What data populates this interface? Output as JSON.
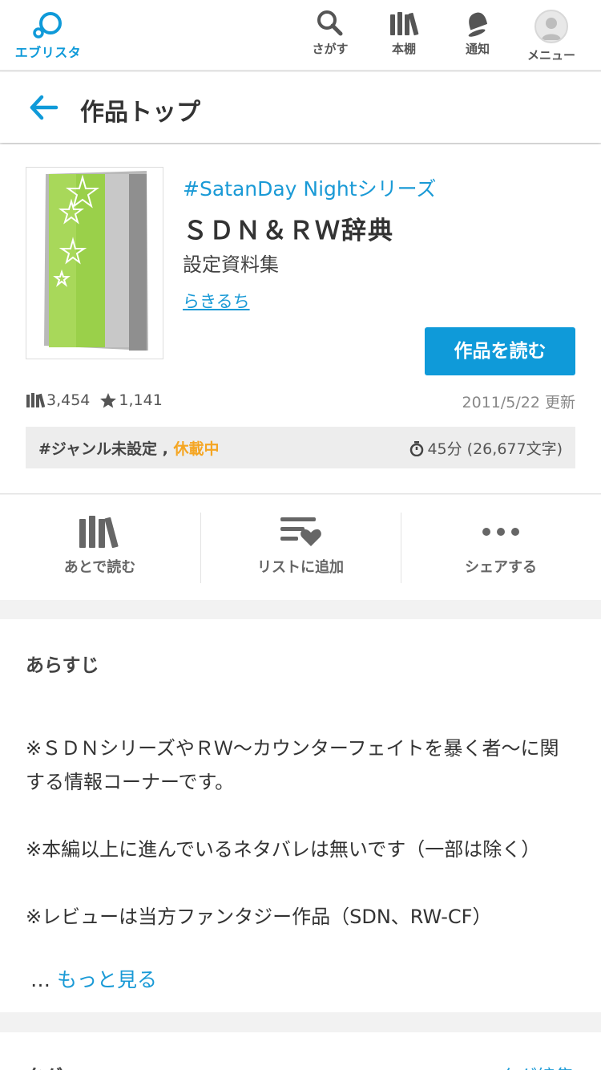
{
  "app": {
    "logo_text": "エブリスタ",
    "brand_color": "#0f9ad9"
  },
  "nav": [
    {
      "label": "さがす",
      "icon": "search-icon"
    },
    {
      "label": "本棚",
      "icon": "bookshelf-icon"
    },
    {
      "label": "通知",
      "icon": "bell-icon"
    },
    {
      "label": "メニュー",
      "icon": "avatar-icon"
    }
  ],
  "page": {
    "title": "作品トップ",
    "back_icon": "back-arrow-icon"
  },
  "work": {
    "series": "#SatanDay Nightシリーズ",
    "title": "ＳＤＮ＆ＲＷ辞典",
    "subtitle": "設定資料集",
    "author": "らきるち",
    "read_button": "作品を読む",
    "bookshelf_count": "3,454",
    "star_count": "1,141",
    "updated": "2011/5/22 更新",
    "genre": "#ジャンル未設定",
    "separator": ",",
    "status": "休載中",
    "read_time": "45分 (26,677文字)"
  },
  "actions": [
    {
      "label": "あとで読む",
      "icon": "bookshelf-icon"
    },
    {
      "label": "リストに追加",
      "icon": "list-heart-icon"
    },
    {
      "label": "シェアする",
      "icon": "more-dots-icon"
    }
  ],
  "synopsis": {
    "heading": "あらすじ",
    "paragraphs": [
      "※ＳＤＮシリーズやＲＷ～カウンターフェイトを暴く者～に関する情報コーナーです。",
      "※本編以上に進んでいるネタバレは無いです（一部は除く）",
      "※レビューは当方ファンタジー作品（SDN、RW-CF）"
    ],
    "ellipsis": "…",
    "more": "もっと見る"
  },
  "tags": {
    "heading": "タグ",
    "link": "タグ編集"
  }
}
